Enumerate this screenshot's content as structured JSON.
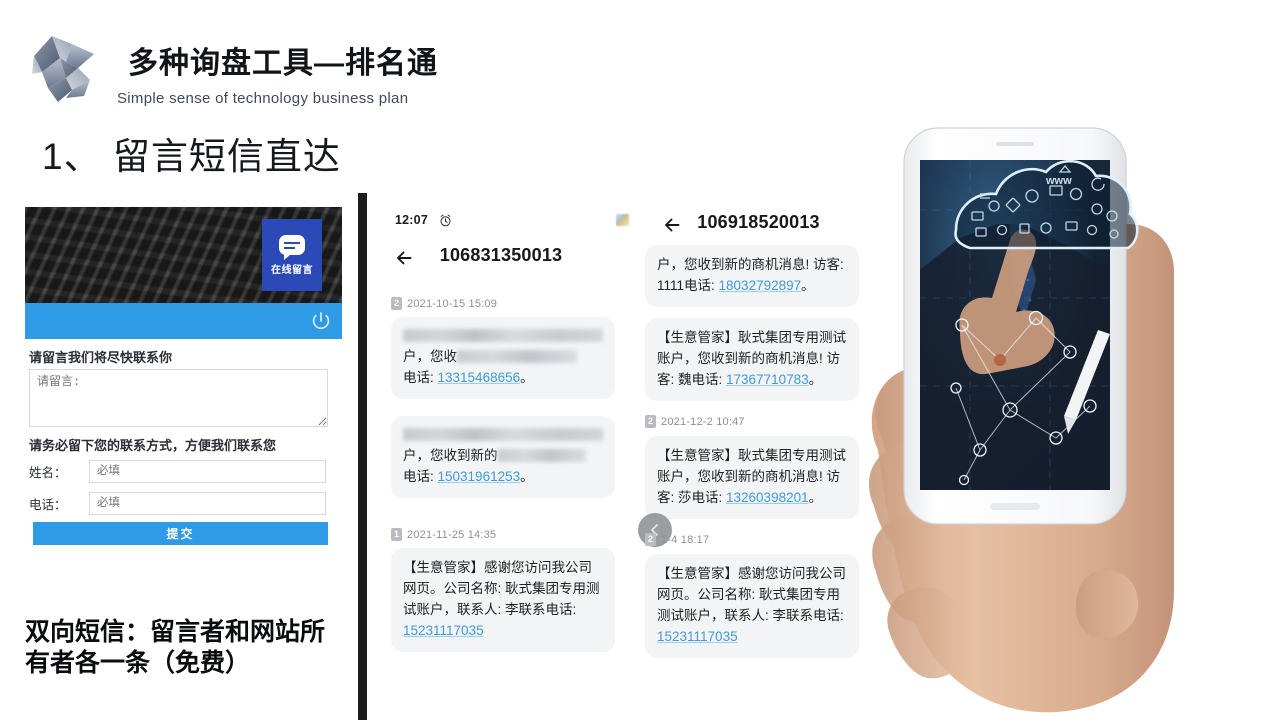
{
  "header": {
    "logo_name": "polygon-crystal-logo",
    "title": "多种询盘工具—排名通",
    "subtitle": "Simple sense of technology business plan",
    "section_heading": "1、 留言短信直达"
  },
  "webform": {
    "tab": {
      "label": "在线留言",
      "icon": "chat-bubble-icon"
    },
    "power_icon": "power-icon",
    "prompt_message": "请留言我们将尽快联系你",
    "textarea_placeholder": "请留言:",
    "textarea_value": "",
    "prompt_contact": "请务必留下您的联系方式，方便我们联系您",
    "fields": [
      {
        "label": "姓名：",
        "placeholder": "必填",
        "value": ""
      },
      {
        "label": "电话：",
        "placeholder": "必填",
        "value": ""
      }
    ],
    "submit_label": "提交"
  },
  "tagline": "双向短信：留言者和网站所有者各一条（免费）",
  "sms_left": {
    "status_time": "12:07",
    "alarm_icon": "alarm-clock-icon",
    "signal_icon": "signal-indicator-icon",
    "back_icon": "back-arrow-icon",
    "number": "106831350013",
    "threads": [
      {
        "timestamp": "2021-10-15 15:09",
        "sim": "2",
        "redacted": true,
        "line_tail": "户，您收",
        "phone_label": "电话: ",
        "phone": "13315468656",
        "suffix": "。"
      },
      {
        "timestamp": "",
        "sim": "",
        "redacted": true,
        "line_tail": "户，您收到新的",
        "phone_label": "电话: ",
        "phone": "15031961253",
        "suffix": "。"
      },
      {
        "timestamp": "2021-11-25 14:35",
        "sim": "1",
        "redacted": false,
        "text": "【生意管家】感谢您访问我公司网页。公司名称: 耿式集团专用测试账户，联系人: 李联系电话: ",
        "phone": "15231117035",
        "suffix": ""
      }
    ]
  },
  "sms_right": {
    "back_icon": "back-arrow-icon",
    "number": "106918520013",
    "scroll_top_icon": "chevron-left-icon",
    "threads": [
      {
        "timestamp": "",
        "sim": "",
        "text": "户，您收到新的商机消息! 访客: 1111电话: ",
        "phone": "18032792897",
        "suffix": "。"
      },
      {
        "timestamp": "",
        "sim": "",
        "text": "【生意管家】耿式集团专用测试账户，您收到新的商机消息! 访客: 魏电话: ",
        "phone": "17367710783",
        "suffix": "。"
      },
      {
        "timestamp": "2021-12-2 10:47",
        "sim": "2",
        "text": "【生意管家】耿式集团专用测试账户，您收到新的商机消息! 访客: 莎电话: ",
        "phone": "13260398201",
        "suffix": "。"
      },
      {
        "timestamp": "1-4 18:17",
        "sim": "2",
        "text": "【生意管家】感谢您访问我公司网页。公司名称: 耿式集团专用测试账户，联系人: 李联系电话: ",
        "phone": "15231117035",
        "suffix": ""
      }
    ]
  },
  "photo": {
    "name": "hand-holding-smartphone-cloud-tech-photo"
  },
  "colors": {
    "accent_blue": "#2f9ae5",
    "tab_blue": "#2b49b7",
    "link_blue": "#3e9ad8",
    "bubble_bg": "#f3f4f6",
    "title_text": "#111418"
  }
}
